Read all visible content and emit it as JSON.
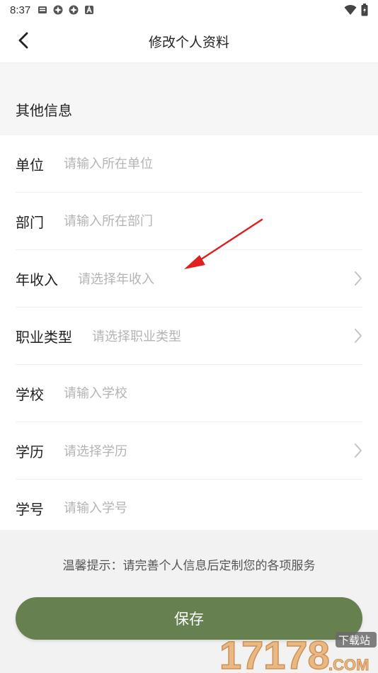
{
  "status_bar": {
    "time": "8:37",
    "left_icons": [
      "mail-icon",
      "app-icon-1",
      "app-icon-2",
      "a-badge-icon"
    ],
    "right_icons": [
      "wifi-icon",
      "battery-icon"
    ]
  },
  "nav": {
    "title": "修改个人资料",
    "back_icon": "back-arrow-icon"
  },
  "section": {
    "title": "其他信息"
  },
  "form": {
    "rows": [
      {
        "label": "单位",
        "placeholder": "请输入所在单位",
        "type": "input"
      },
      {
        "label": "部门",
        "placeholder": "请输入所在部门",
        "type": "input"
      },
      {
        "label": "年收入",
        "placeholder": "请选择年收入",
        "type": "select"
      },
      {
        "label": "职业类型",
        "placeholder": "请选择职业类型",
        "type": "select"
      },
      {
        "label": "学校",
        "placeholder": "请输入学校",
        "type": "input"
      },
      {
        "label": "学历",
        "placeholder": "请选择学历",
        "type": "select"
      },
      {
        "label": "学号",
        "placeholder": "请输入学号",
        "type": "input"
      }
    ]
  },
  "tip": "温馨提示：请完善个人信息后定制您的各项服务",
  "save_label": "保存",
  "watermark": {
    "brand": "17178",
    "domain": "COM",
    "badge": "下载站"
  },
  "colors": {
    "accent": "#66804f",
    "placeholder": "#b4b4b4",
    "annotation_arrow": "#e02020"
  }
}
